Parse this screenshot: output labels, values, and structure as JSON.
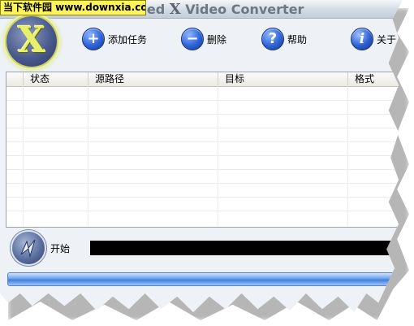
{
  "watermark": {
    "text": "当下软件园 www.downxia.com"
  },
  "window": {
    "title_prefix": "nced ",
    "title_x": "X",
    "title_suffix": " Video Converter"
  },
  "toolbar": {
    "add_task": {
      "label": "添加任务",
      "icon": "plus-icon",
      "glyph": "+"
    },
    "delete": {
      "label": "删除",
      "icon": "minus-icon",
      "glyph": "−"
    },
    "help": {
      "label": "帮助",
      "icon": "question-icon",
      "glyph": "?"
    },
    "about": {
      "label": "关于",
      "icon": "info-icon",
      "glyph": "i"
    }
  },
  "logo": {
    "glyph": "X"
  },
  "task_table": {
    "columns": [
      "",
      "状态",
      "源路径",
      "目标",
      "格式"
    ],
    "rows": []
  },
  "bottom": {
    "start_label": "开始",
    "start_icon": "start-convert-icon",
    "status_text": "",
    "progress": 1.0
  },
  "colors": {
    "watermark_bg": "#fff45a",
    "progress_fill": "#3f7fdc",
    "status_bar": "#000000",
    "logo_glyph": "#e8f06a"
  }
}
